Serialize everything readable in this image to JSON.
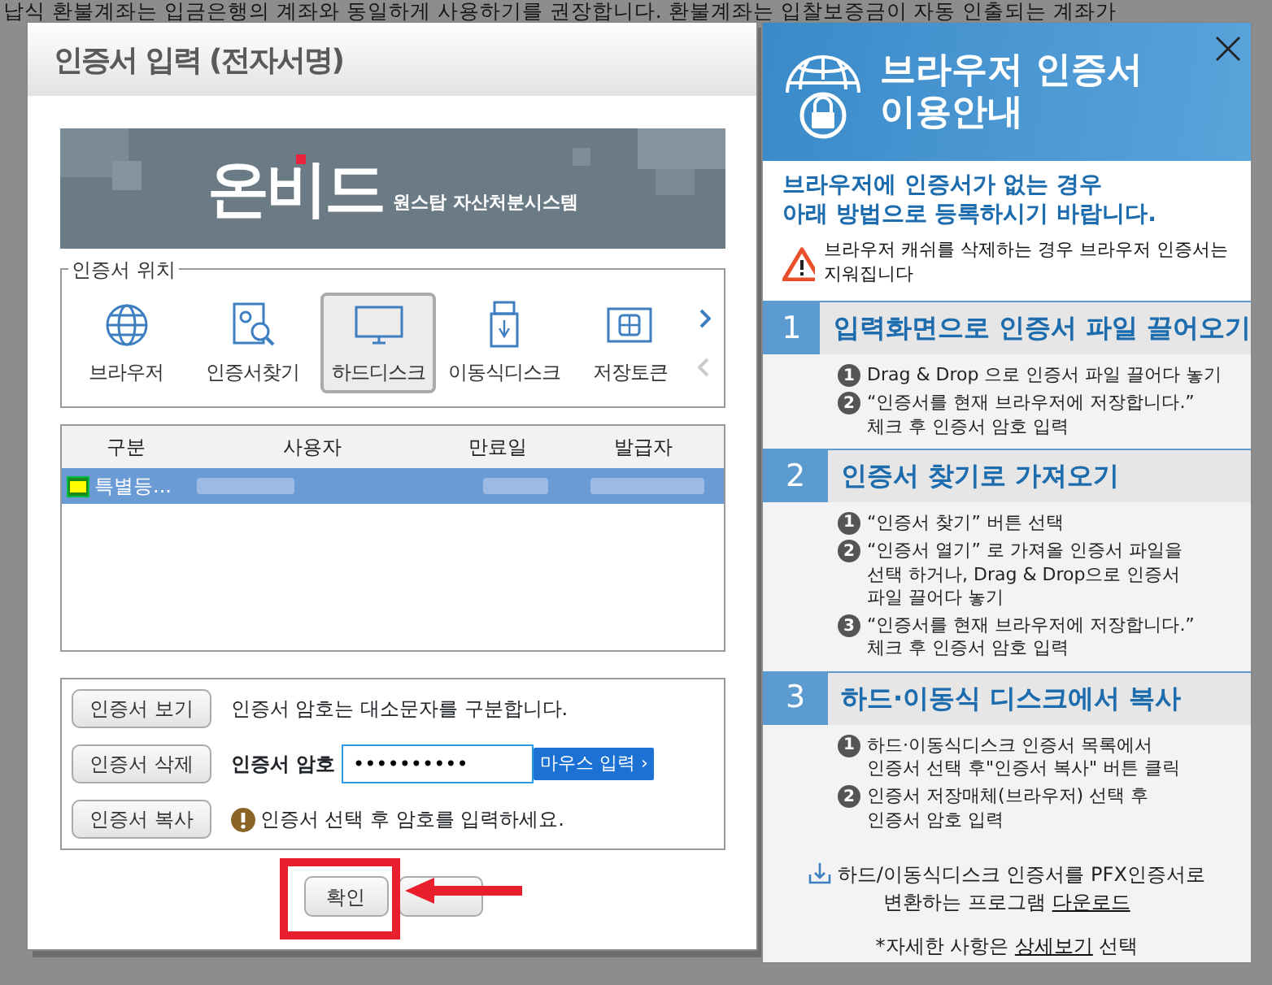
{
  "background_text": "납식 환불계좌는 입금은행의 계좌와 동일하게 사용하기를 권장합니다. 환불계좌는 입찰보증금이 자동 인출되는 계좌가",
  "cert_dialog": {
    "title": "인증서 입력 (전자서명)",
    "logo": {
      "brand": "온비드",
      "subtitle": "원스탑 자산처분시스템"
    },
    "location": {
      "legend": "인증서 위치",
      "items": [
        {
          "label": "브라우저",
          "selected": false
        },
        {
          "label": "인증서찾기",
          "selected": false
        },
        {
          "label": "하드디스크",
          "selected": true
        },
        {
          "label": "이동식디스크",
          "selected": false
        },
        {
          "label": "저장토큰",
          "selected": false
        }
      ]
    },
    "table": {
      "columns": [
        "구분",
        "사용자",
        "만료일",
        "발급자"
      ],
      "rows": [
        {
          "type": "특별등...",
          "selected": true
        }
      ]
    },
    "actions": [
      "인증서 보기",
      "인증서 삭제",
      "인증서 복사"
    ],
    "case_hint": "인증서 암호는 대소문자를 구분합니다.",
    "password": {
      "label": "인증서 암호",
      "masked": "••••••••••",
      "mouse_button": "마우스 입력 ›"
    },
    "warning": "인증서 선택 후 암호를 입력하세요.",
    "footer_buttons": [
      {
        "label": "확인",
        "highlighted": true
      },
      {
        "highlighted": false
      }
    ]
  },
  "guide": {
    "title_lines": [
      "브라우저 인증서",
      "이용안내"
    ],
    "notice_lines": [
      "브라우저에 인증서가 없는 경우",
      "아래 방법으로 등록하시기 바랍니다."
    ],
    "warning": "브라우저 캐쉬를 삭제하는 경우 브라우저 인증서는 지워집니다",
    "sections": [
      {
        "number": "1",
        "title": "입력화면으로 인증서 파일 끌어오기",
        "steps": [
          {
            "number": "1",
            "lines": [
              "Drag & Drop 으로 인증서 파일 끌어다 놓기"
            ]
          },
          {
            "number": "2",
            "lines": [
              "“인증서를 현재 브라우저에 저장합니다.”",
              "체크 후 인증서 암호 입력"
            ]
          }
        ]
      },
      {
        "number": "2",
        "title": "인증서 찾기로 가져오기",
        "steps": [
          {
            "number": "1",
            "lines": [
              "“인증서 찾기” 버튼 선택"
            ]
          },
          {
            "number": "2",
            "lines": [
              "“인증서 열기” 로 가져올 인증서 파일을",
              "선택 하거나, Drag & Drop으로 인증서",
              "파일 끌어다 놓기"
            ]
          },
          {
            "number": "3",
            "lines": [
              "“인증서를 현재 브라우저에 저장합니다.”",
              "체크 후 인증서 암호 입력"
            ]
          }
        ]
      },
      {
        "number": "3",
        "title": "하드·이동식 디스크에서 복사",
        "steps": [
          {
            "number": "1",
            "lines": [
              "하드·이동식디스크 인증서 목록에서",
              "인증서 선택 후\"인증서 복사\" 버튼 클릭"
            ]
          },
          {
            "number": "2",
            "lines": [
              "인증서 저장매체(브라우저) 선택 후",
              "인증서 암호 입력"
            ]
          }
        ]
      }
    ],
    "download": {
      "lines": [
        "하드/이동식디스크 인증서를 PFX인증서로",
        "변환하는 프로그램"
      ],
      "link": "다운로드"
    },
    "detail": {
      "before": "*자세한 사항은",
      "link": "상세보기",
      "after": "선택"
    }
  }
}
